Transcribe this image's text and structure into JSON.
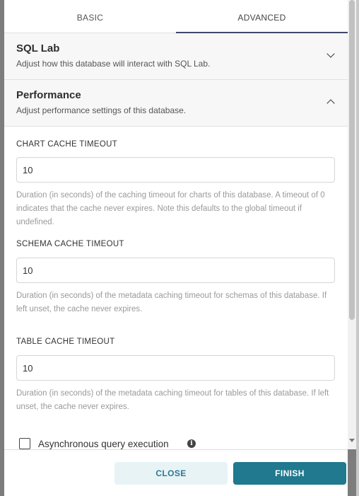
{
  "tabs": [
    {
      "label": "BASIC",
      "active": false
    },
    {
      "label": "ADVANCED",
      "active": true
    }
  ],
  "panels": {
    "sql_lab": {
      "title": "SQL Lab",
      "subtitle": "Adjust how this database will interact with SQL Lab.",
      "expanded": false
    },
    "performance": {
      "title": "Performance",
      "subtitle": "Adjust performance settings of this database.",
      "expanded": true
    }
  },
  "fields": {
    "chart_cache": {
      "label": "CHART CACHE TIMEOUT",
      "value": "10",
      "help": "Duration (in seconds) of the caching timeout for charts of this database. A timeout of 0 indicates that the cache never expires. Note this defaults to the global timeout if undefined."
    },
    "schema_cache": {
      "label": "SCHEMA CACHE TIMEOUT",
      "value": "10",
      "help": "Duration (in seconds) of the metadata caching timeout for schemas of this database. If left unset, the cache never expires."
    },
    "table_cache": {
      "label": "TABLE CACHE TIMEOUT",
      "value": "10",
      "help": "Duration (in seconds) of the metadata caching timeout for tables of this database. If left unset, the cache never expires."
    }
  },
  "async_query": {
    "label": "Asynchronous query execution",
    "checked": false,
    "info_icon": "info-icon"
  },
  "footer": {
    "close_label": "CLOSE",
    "finish_label": "FINISH"
  },
  "colors": {
    "primary": "#20798e",
    "primary_light": "#e8f3f6",
    "tab_indicator": "#40486b"
  }
}
